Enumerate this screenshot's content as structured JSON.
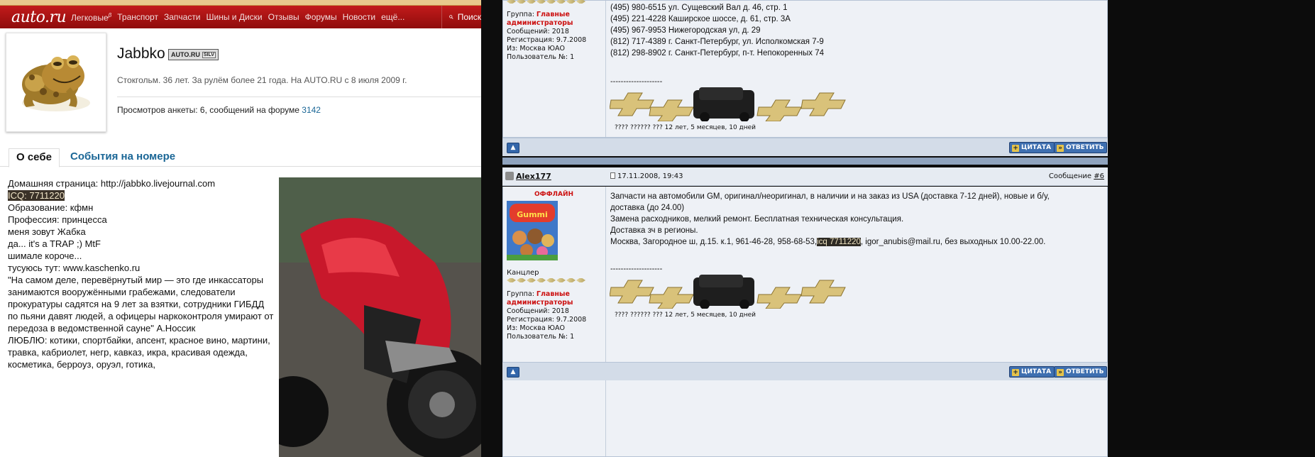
{
  "nav": {
    "logo": "auto.ru",
    "links": [
      "Легковые",
      "Транспорт",
      "Запчасти",
      "Шины и Диски",
      "Отзывы",
      "Форумы",
      "Новости",
      "ещё..."
    ],
    "beta_mark": "β",
    "search_label": "Поиск"
  },
  "profile": {
    "username": "Jabbko",
    "badge_label": "AUTO.RU",
    "badge_sub": "SILV",
    "subline": "Стокгольм. 36 лет. За рулём более 21 года. На AUTO.RU с 8 июля 2009 г.",
    "views_prefix": "Просмотров анкеты: 6, сообщений на форуме",
    "forum_posts": "3142"
  },
  "tabs": [
    "О себе",
    "События на номере"
  ],
  "about": {
    "lines": [
      "Домашняя страница: http://jabbko.livejournal.com",
      "ICQ: 7711220",
      "Образование: кфмн",
      "Профессия: принцесса",
      "меня зовут Жабка",
      "да... it's a TRAP ;) MtF",
      "шимале короче...",
      "тусуюсь тут: www.kaschenko.ru",
      "\"На самом деле, перевёрнутый мир — это где инкассаторы занимаются вооружёнными грабежами, следователи прокуратуры садятся на 9 лет за взятки, сотрудники ГИБДД по пьяни давят людей, а офицеры наркоконтроля умирают от передоза в ведомственной сауне\" А.Носсик",
      "ЛЮБЛЮ: котики, спортбайки, апсент, красное вино, мартини, травка, кабриолет, негр, кавказ, икра, красивая одежда, косметика, берроуз, оруэл, готика,"
    ]
  },
  "post1": {
    "group_label": "Группа:",
    "group_value": "Главные администраторы",
    "messages": "Сообщений: 2018",
    "registered": "Регистрация: 9.7.2008",
    "from": "Из: Москва ЮАО",
    "user_no": "Пользователь №: 1",
    "lines": [
      "(495) 980-6515 ул. Сущевский Вал д. 46, стр. 1",
      "(495) 221-4228 Каширское шоссе, д. 61, стр. 3А",
      "(495) 967-9953 Нижегородская ул, д. 29",
      "(812) 717-4389 г. Санкт-Петербург, ул. Исполкомская 7-9",
      "(812) 298-8902 г. Санкт-Петербург, п-т. Непокоренных 74"
    ],
    "dashes": "--------------------",
    "sig_caption": "???? ?????? ??? 12 лет, 5 месяцев, 10 дней",
    "quote_btn": "ЦИТАТА",
    "reply_btn": "ОТВЕТИТЬ"
  },
  "post2": {
    "author": "Alex177",
    "date": "17.11.2008, 19:43",
    "msg_label": "Сообщение",
    "msg_no": "#6",
    "status": "ОФФЛАЙН",
    "rank": "Канцлер",
    "group_label": "Группа:",
    "group_value": "Главные администраторы",
    "messages": "Сообщений: 2018",
    "registered": "Регистрация: 9.7.2008",
    "from": "Из: Москва ЮАО",
    "user_no": "Пользователь №: 1",
    "text_line1": "Запчасти на автомобили GM, оригинал/неоригинал, в наличии и на заказ из USA (доставка 7-12 дней), новые и б/у,",
    "text_line2": "доставка (до 24.00)",
    "text_line3": "Замена расходников, мелкий ремонт. Бесплатная техническая консультация.",
    "text_line4": "Доставка зч в регионы.",
    "text_line5_a": "Москва, Загородное ш, д.15. к.1, 961-46-28, 958-68-53,",
    "text_line5_hl": "icq 7711220",
    "text_line5_b": ", igor_anubis@mail.ru, без выходных 10.00-22.00.",
    "dashes": "--------------------",
    "sig_caption": "???? ?????? ??? 12 лет, 5 месяцев, 10 дней",
    "quote_btn": "ЦИТАТА",
    "reply_btn": "ОТВЕТИТЬ"
  },
  "colors": {
    "nav_red": "#b31515",
    "link_blue": "#1a6696",
    "forum_bg": "#eef1f6",
    "forum_button": "#3e6fb0",
    "admin_red": "#cc1111"
  }
}
